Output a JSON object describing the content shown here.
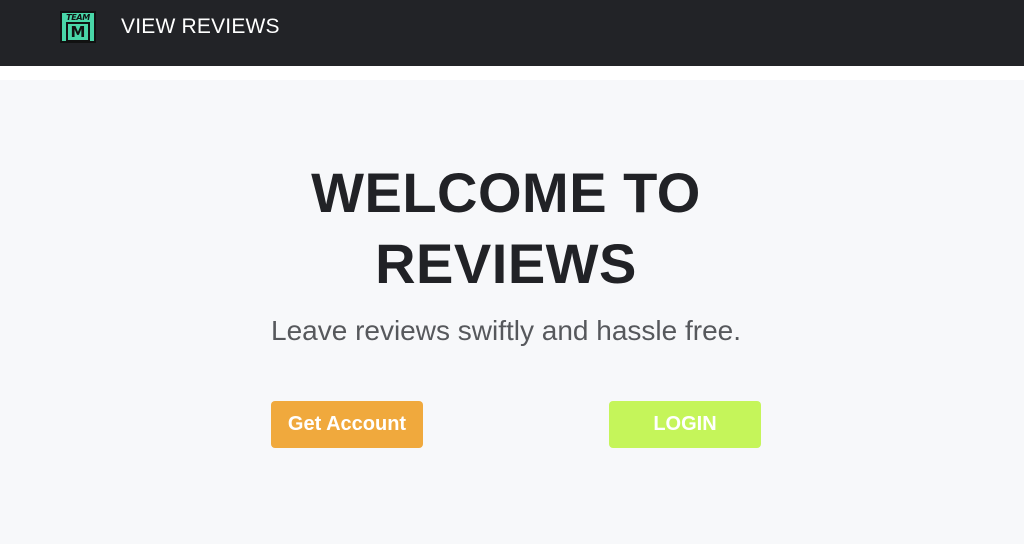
{
  "navbar": {
    "logo": {
      "top_text": "TEAM",
      "letter": "M"
    },
    "link_label": "VIEW REVIEWS"
  },
  "hero": {
    "title_line1": "WELCOME TO",
    "title_line2": "REVIEWS",
    "subtitle": "Leave reviews swiftly and hassle free.",
    "buttons": {
      "get_account_label": "Get Account",
      "login_label": "LOGIN"
    }
  },
  "colors": {
    "navbar_bg": "#222327",
    "page_bg": "#f7f8fa",
    "logo_bg": "#49d6a8",
    "get_account_bg": "#f0a93d",
    "login_bg": "#c5f55a",
    "title_text": "#212226",
    "subtitle_text": "#56585c"
  }
}
